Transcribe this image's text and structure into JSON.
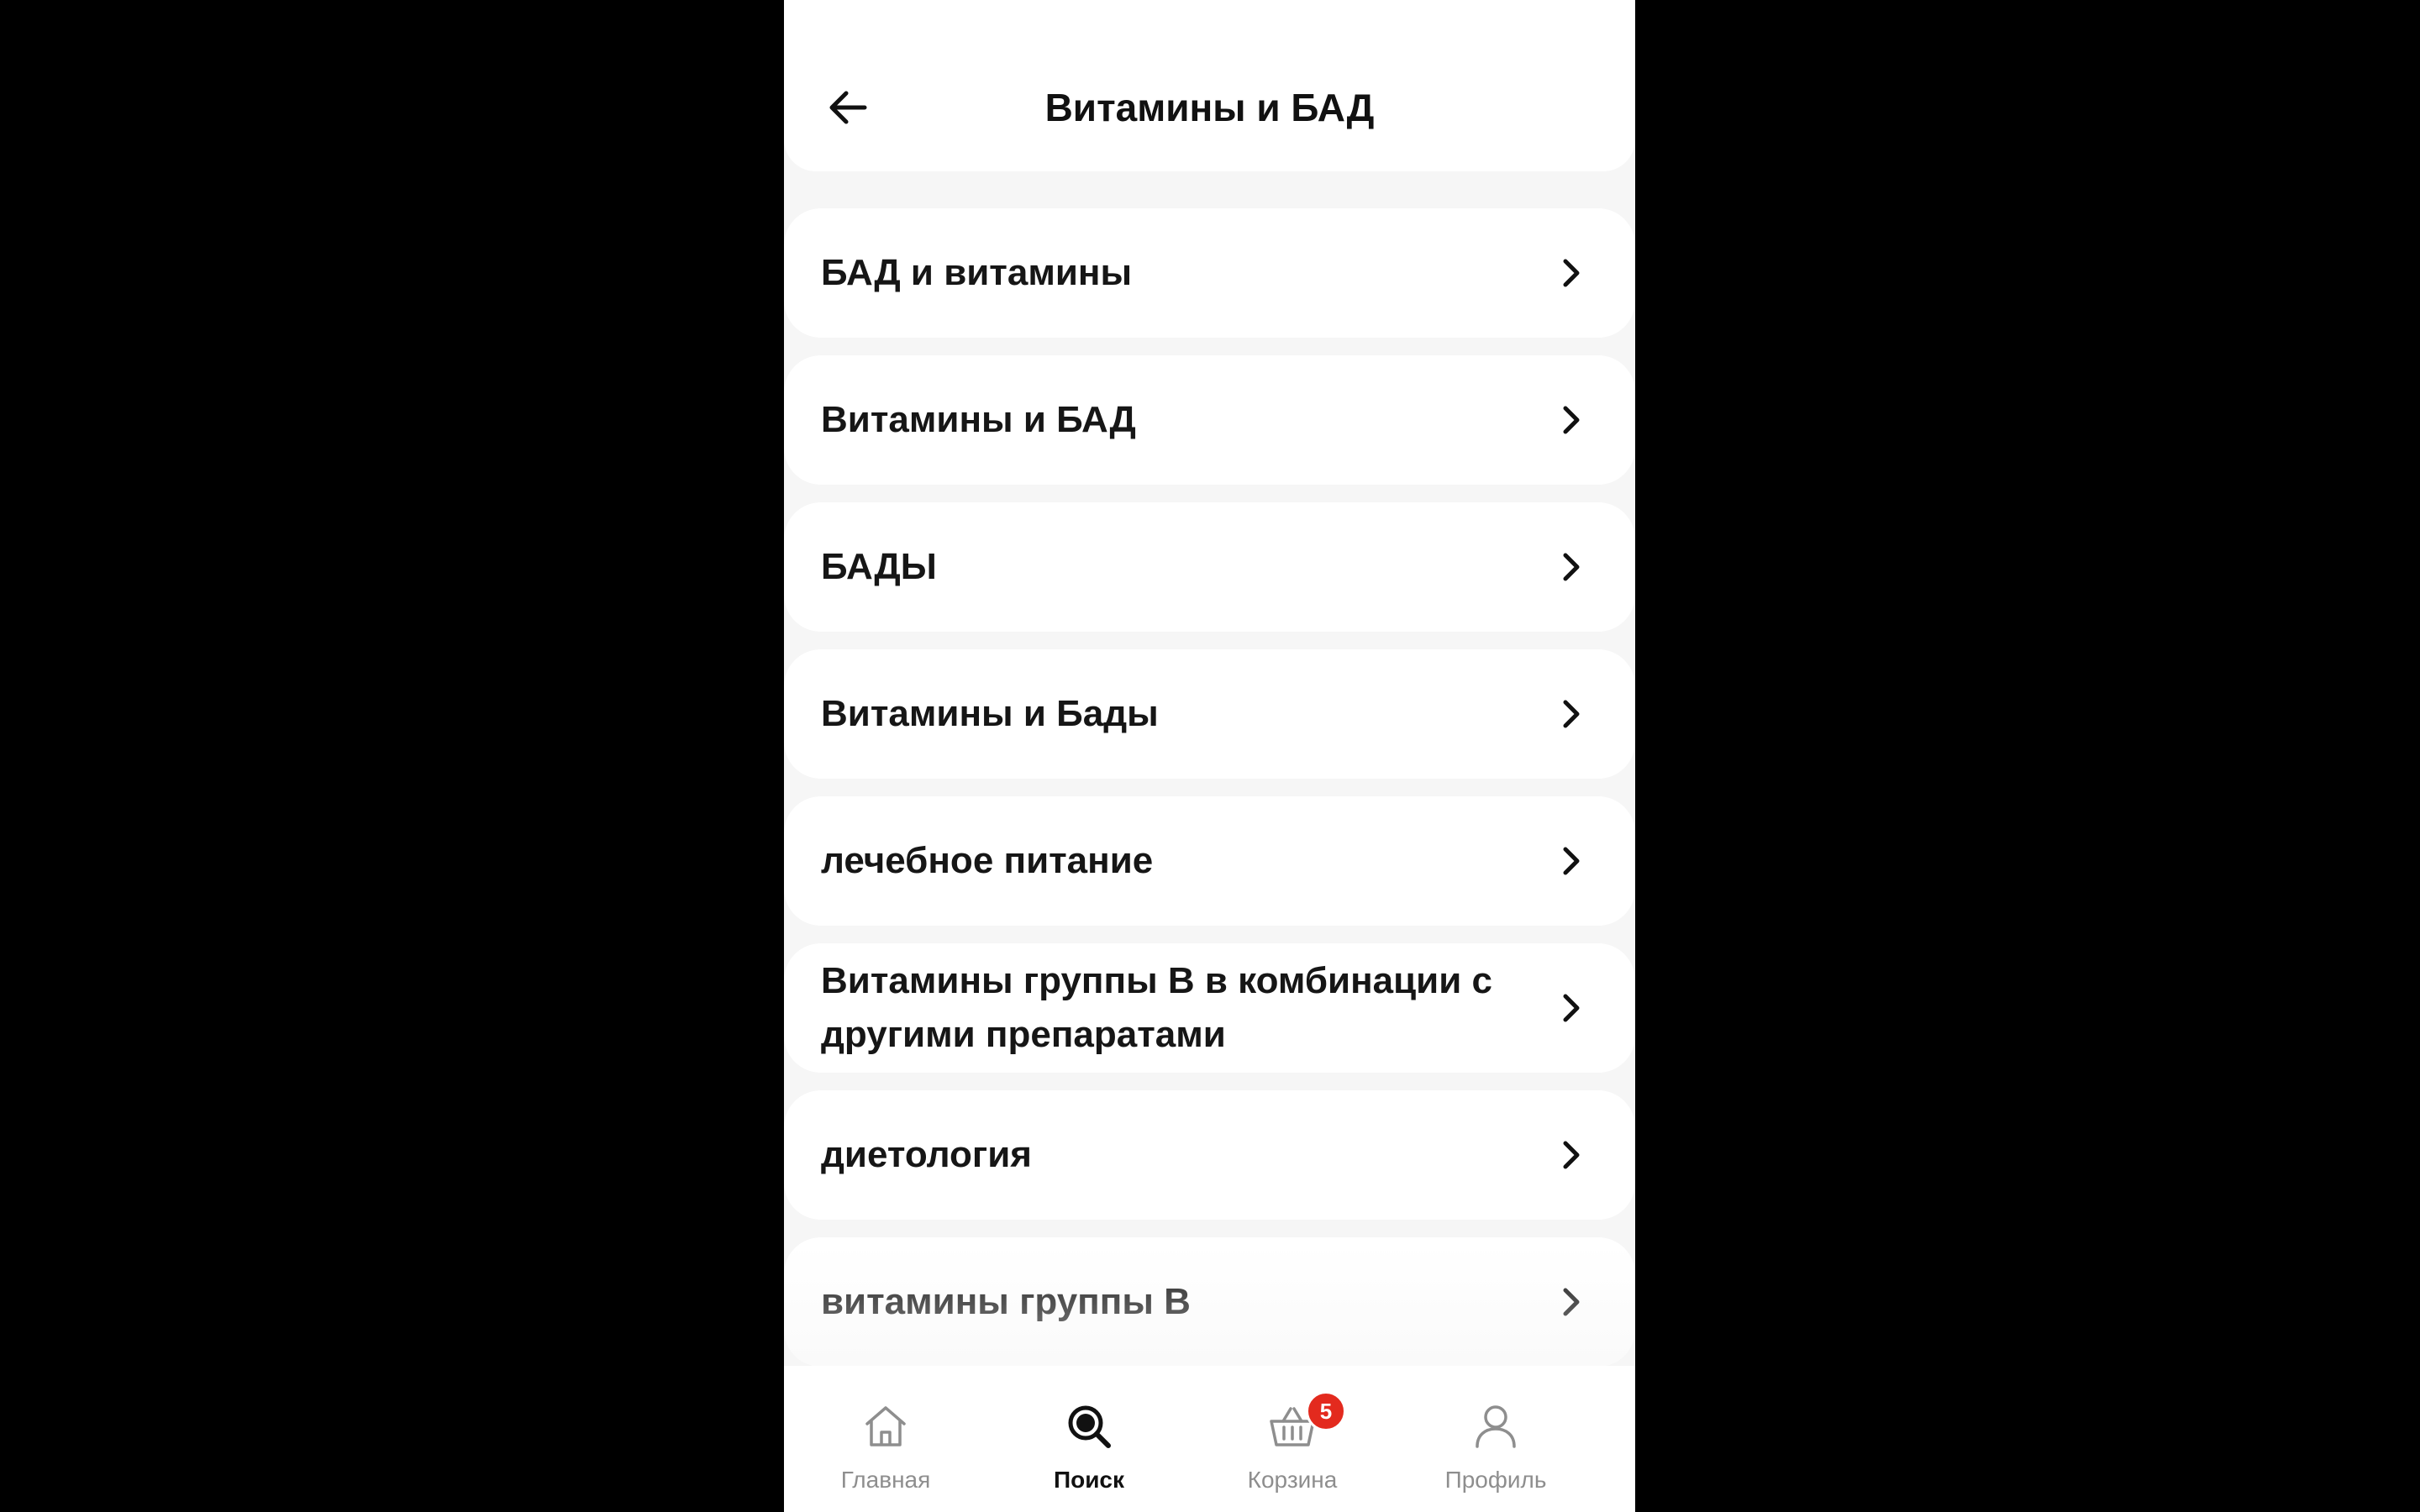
{
  "header": {
    "title": "Витамины и БАД",
    "back_icon": "arrow-left-icon"
  },
  "categories": [
    {
      "label": "БАД и витамины"
    },
    {
      "label": "Витамины и БАД"
    },
    {
      "label": "БАДЫ"
    },
    {
      "label": "Витамины и Бады"
    },
    {
      "label": "лечебное питание"
    },
    {
      "label": "Витамины группы В в комбинации с другими препаратами"
    },
    {
      "label": "диетология"
    },
    {
      "label": "витамины группы В"
    }
  ],
  "tabbar": {
    "active": "search",
    "tabs": [
      {
        "id": "home",
        "label": "Главная",
        "icon": "home-icon"
      },
      {
        "id": "search",
        "label": "Поиск",
        "icon": "search-icon"
      },
      {
        "id": "cart",
        "label": "Корзина",
        "icon": "basket-icon",
        "badge": "5"
      },
      {
        "id": "profile",
        "label": "Профиль",
        "icon": "user-icon"
      }
    ]
  },
  "colors": {
    "background": "#f6f6f6",
    "surface": "#ffffff",
    "text": "#161616",
    "muted": "#8e8e8e",
    "badge": "#e32a1e"
  }
}
